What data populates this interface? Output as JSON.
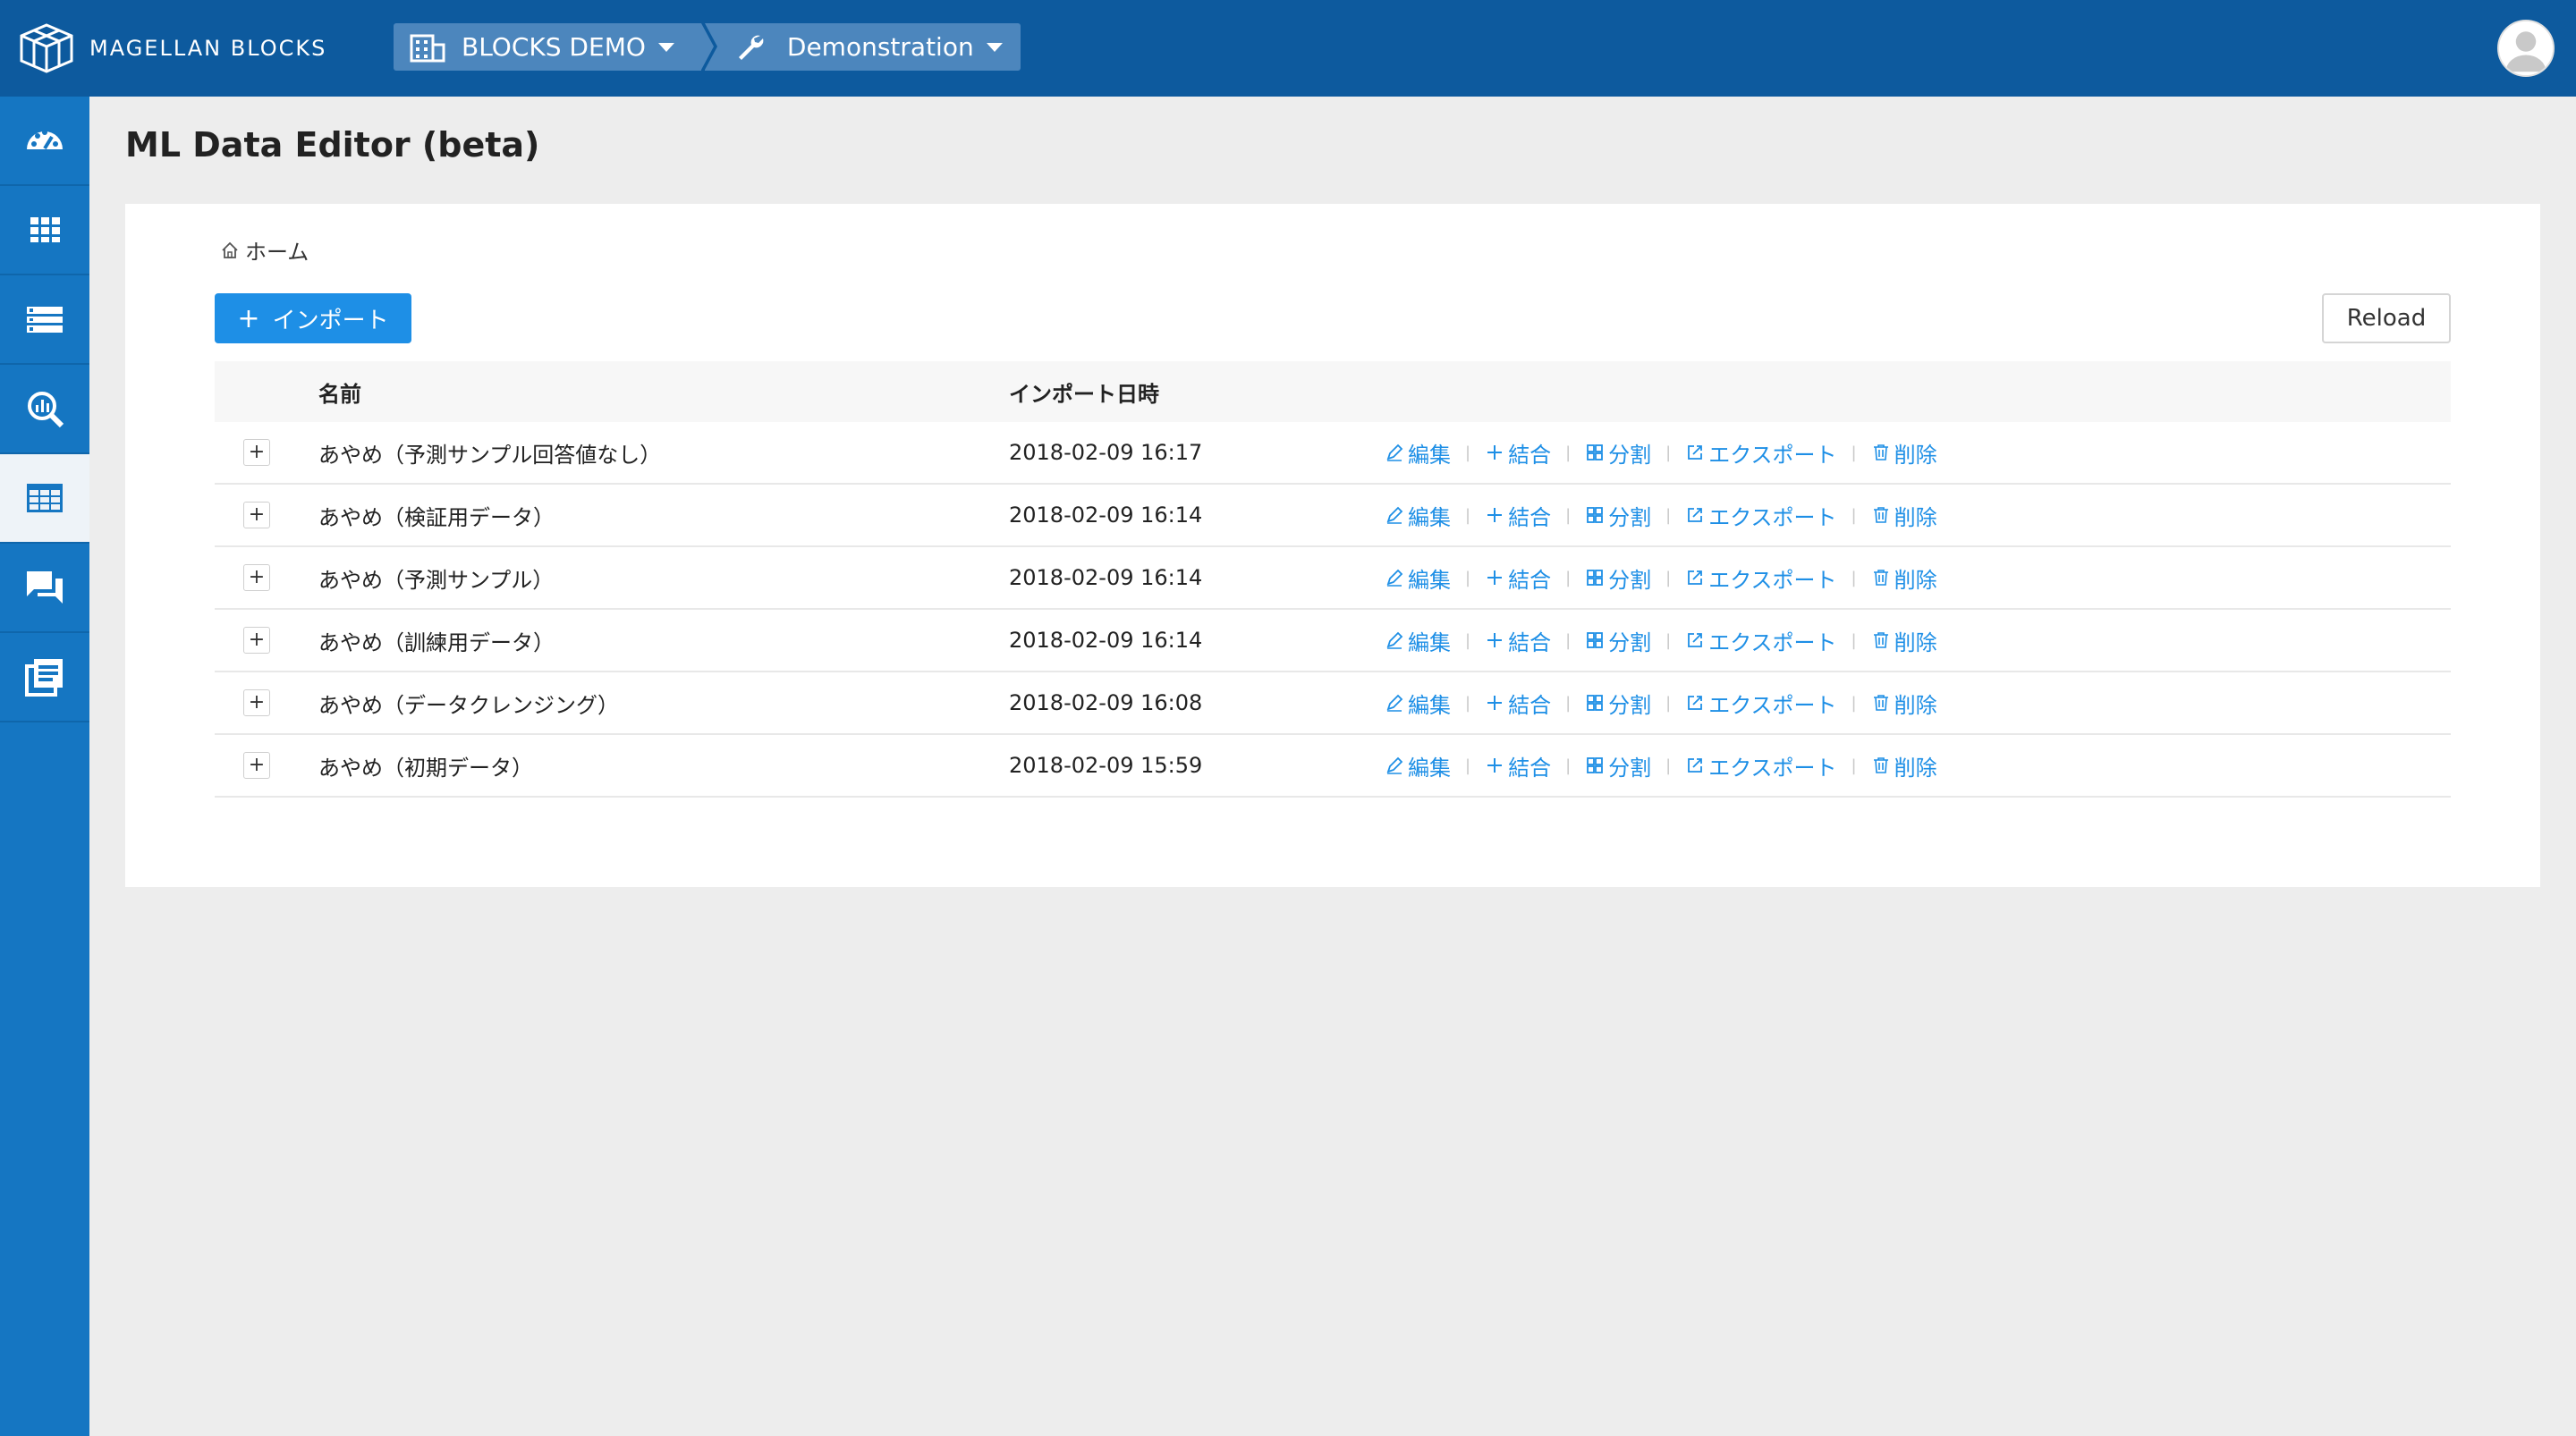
{
  "header": {
    "brand": "MAGELLAN BLOCKS",
    "org": "BLOCKS DEMO",
    "project": "Demonstration"
  },
  "sidebar": {
    "items": [
      {
        "icon": "dashboard-icon"
      },
      {
        "icon": "grid-icon"
      },
      {
        "icon": "list-icon"
      },
      {
        "icon": "analytics-search-icon"
      },
      {
        "icon": "table-icon",
        "active": true
      },
      {
        "icon": "chat-icon"
      },
      {
        "icon": "documents-icon"
      }
    ]
  },
  "page": {
    "title": "ML Data Editor (beta)",
    "home_crumb": "ホーム",
    "import_label": "インポート",
    "reload_label": "Reload"
  },
  "table": {
    "headers": {
      "name": "名前",
      "date": "インポート日時"
    },
    "action_labels": {
      "edit": "編集",
      "merge": "結合",
      "split": "分割",
      "export": "エクスポート",
      "delete": "削除"
    },
    "rows": [
      {
        "name": "あやめ（予測サンプル回答値なし）",
        "date": "2018-02-09 16:17"
      },
      {
        "name": "あやめ（検証用データ）",
        "date": "2018-02-09 16:14"
      },
      {
        "name": "あやめ（予測サンプル）",
        "date": "2018-02-09 16:14"
      },
      {
        "name": "あやめ（訓練用データ）",
        "date": "2018-02-09 16:14"
      },
      {
        "name": "あやめ（データクレンジング）",
        "date": "2018-02-09 16:08"
      },
      {
        "name": "あやめ（初期データ）",
        "date": "2018-02-09 15:59"
      }
    ]
  },
  "colors": {
    "topbar": "#0d5a9e",
    "sidebar": "#1576c2",
    "accent": "#1e8fe6"
  }
}
